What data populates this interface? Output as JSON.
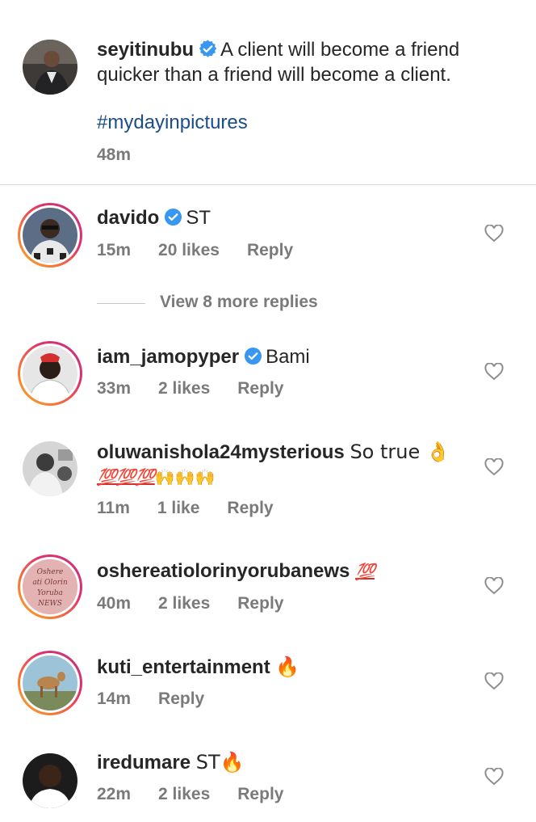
{
  "caption": {
    "username": "seyitinubu",
    "line1": "A client will become a friend",
    "line2": "quicker than a friend will become a client.",
    "hashtag": "#mydayinpictures",
    "time": "48m"
  },
  "view_more": "View 8 more replies",
  "comments": [
    {
      "username": "davido",
      "text": "ST",
      "time": "15m",
      "likes": "20 likes",
      "reply": "Reply"
    },
    {
      "username": "iam_jamopyper",
      "text": "Bami",
      "time": "33m",
      "likes": "2 likes",
      "reply": "Reply"
    },
    {
      "username": "oluwanishola24mysterious",
      "text": "So true 👌",
      "text2_hundreds": "💯💯💯",
      "text2_hands": "🙌🙌🙌",
      "time": "11m",
      "likes": "1 like",
      "reply": "Reply"
    },
    {
      "username": "oshereatiolorinyorubanews",
      "text": "💯",
      "time": "40m",
      "likes": "2 likes",
      "reply": "Reply",
      "avatar_text": [
        "Oshere",
        "ati Olorin",
        "Yoruba",
        "NEWS"
      ]
    },
    {
      "username": "kuti_entertainment",
      "text": "🔥",
      "time": "14m",
      "reply": "Reply"
    },
    {
      "username": "iredumare",
      "text": "ST🔥",
      "time": "22m",
      "likes": "2 likes",
      "reply": "Reply"
    }
  ],
  "colors": {
    "verified": "#3897f0",
    "hashtag": "#1b4d89",
    "meta": "#7a7a7a"
  }
}
